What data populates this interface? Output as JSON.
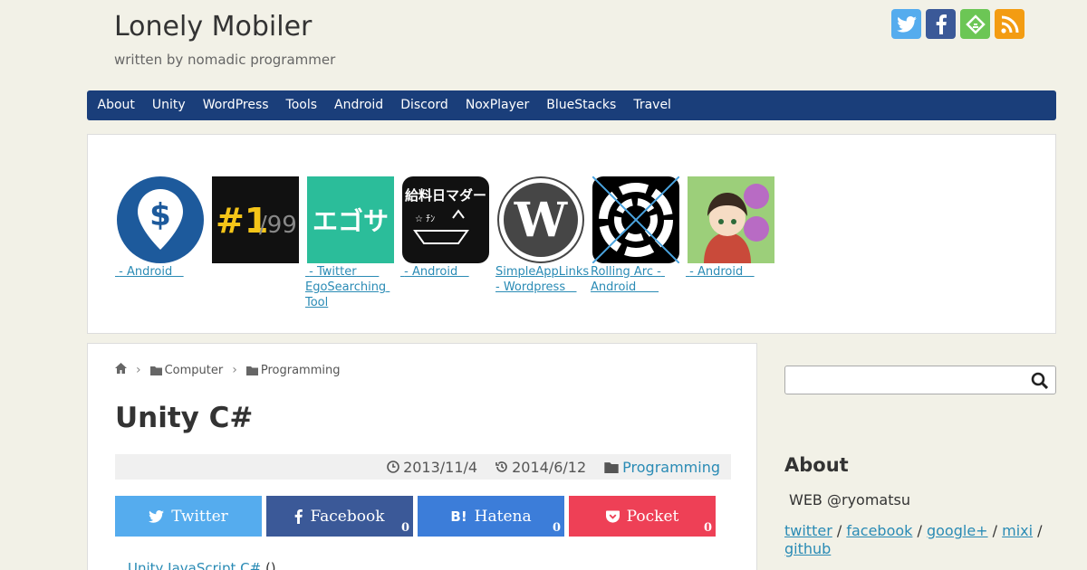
{
  "header": {
    "title": "Lonely Mobiler",
    "description": "written by nomadic programmer"
  },
  "social_icons": [
    "twitter-icon",
    "facebook-icon",
    "feedly-icon",
    "rss-icon"
  ],
  "nav": {
    "items": [
      "About",
      "Unity",
      "WordPress",
      "Tools",
      "Android",
      "Discord",
      "NoxPlayer",
      "BlueStacks",
      "Travel"
    ]
  },
  "apps": [
    {
      "label": " - Android   ",
      "icon": "dollar-pin-icon"
    },
    {
      "label": "",
      "icon": "number-one-icon",
      "icon_text": "#1/99"
    },
    {
      "label": " - Twitter      EgoSearching Tool",
      "icon": "egosa-icon",
      "icon_text": "エゴサ"
    },
    {
      "label": " - Android   ",
      "icon": "payday-icon",
      "icon_text": "給料日マダー"
    },
    {
      "label": "SimpleAppLinks - Wordpress   ",
      "icon": "wordpress-icon"
    },
    {
      "label": "Rolling Arc - Android      ",
      "icon": "rolling-arc-icon"
    },
    {
      "label": " - Android   ",
      "icon": "umbrella-girl-icon"
    }
  ],
  "breadcrumb": {
    "items": [
      "Computer",
      "Programming"
    ]
  },
  "post": {
    "title": "Unity C#",
    "published": "2013/11/4",
    "updated": "2014/6/12",
    "category": "Programming",
    "first_line_link": "Unity  JavaScript  C#",
    "first_line_rest": "  ()"
  },
  "share": {
    "twitter": "Twitter",
    "facebook": "Facebook",
    "facebook_count": "0",
    "hatena": "Hatena",
    "hatena_count": "0",
    "pocket": "Pocket",
    "pocket_count": "0"
  },
  "sidebar": {
    "about_heading": "About",
    "about_web": "WEB  @ryomatsu",
    "links": [
      "twitter",
      "facebook",
      "google+",
      "mixi",
      "github"
    ],
    "separator": " / "
  },
  "colors": {
    "background": "#f2f1e7",
    "nav": "#1a3e7a",
    "link": "#2a8bb5",
    "twitter": "#55acee",
    "facebook": "#3b5998",
    "hatena": "#3c7dd9",
    "pocket": "#ee4056"
  }
}
